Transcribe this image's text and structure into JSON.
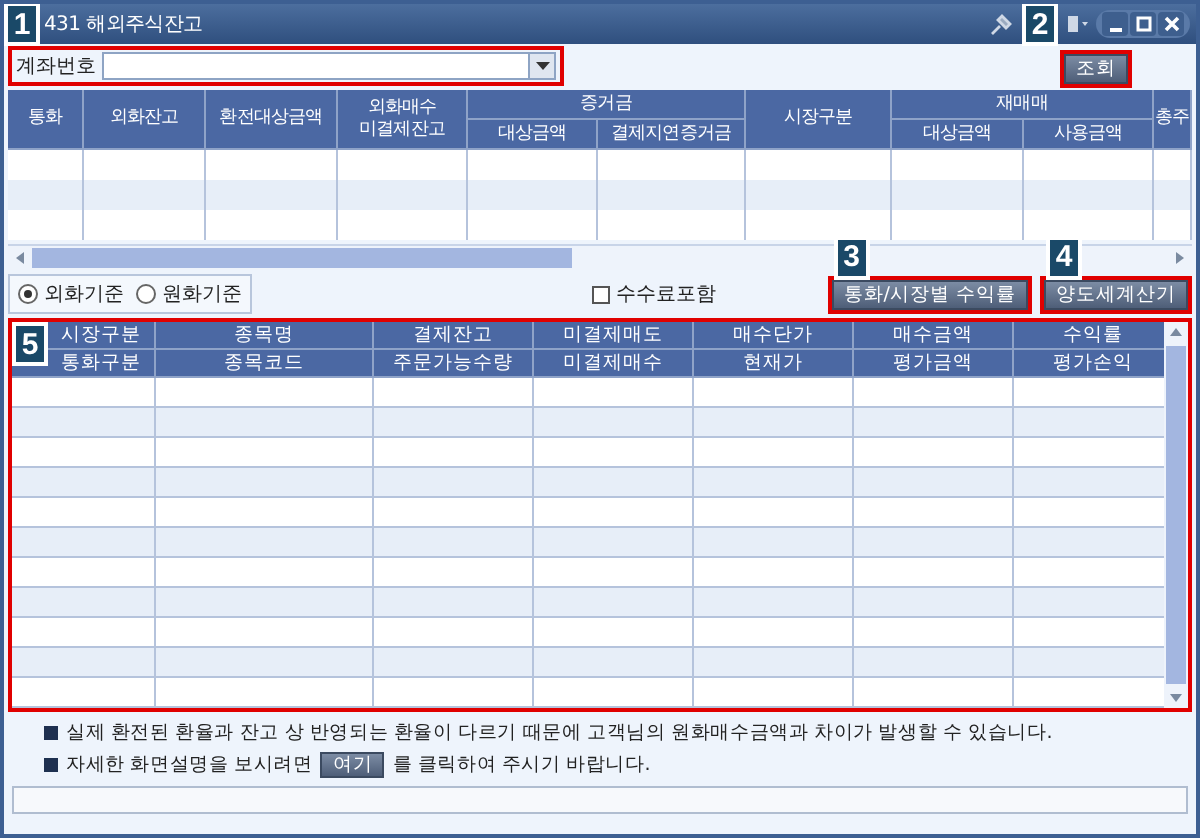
{
  "window": {
    "title": "431 해외주식잔고",
    "callout": "1"
  },
  "account": {
    "label": "계좌번호",
    "callout": "2",
    "query_button": "조회"
  },
  "upper_table": {
    "columns": [
      {
        "label": "통화"
      },
      {
        "label": "외화잔고"
      },
      {
        "label": "환전대상금액"
      },
      {
        "label": "외화매수\n미결제잔고"
      },
      {
        "label": "증거금",
        "sub": [
          "대상금액",
          "결제지연증거금"
        ]
      },
      {
        "label": "시장구분"
      },
      {
        "label": "재매매",
        "sub": [
          "대상금액",
          "사용금액"
        ]
      },
      {
        "label": "총주"
      }
    ]
  },
  "options": {
    "radios": [
      {
        "label": "외화기준",
        "selected": true
      },
      {
        "label": "원화기준",
        "selected": false
      }
    ],
    "checkbox": {
      "label": "수수료포함",
      "checked": false
    },
    "buttons": [
      {
        "label": "통화/시장별 수익률",
        "callout": "3"
      },
      {
        "label": "양도세계산기",
        "callout": "4"
      }
    ]
  },
  "lower_table": {
    "callout": "5",
    "columns": [
      {
        "top": "시장구분",
        "bottom": "통화구분"
      },
      {
        "top": "종목명",
        "bottom": "종목코드"
      },
      {
        "top": "결제잔고",
        "bottom": "주문가능수량"
      },
      {
        "top": "미결제매도",
        "bottom": "미결제매수"
      },
      {
        "top": "매수단가",
        "bottom": "현재가"
      },
      {
        "top": "매수금액",
        "bottom": "평가금액"
      },
      {
        "top": "수익률",
        "bottom": "평가손익"
      }
    ]
  },
  "notes": [
    {
      "kind": "text",
      "text": "실제 환전된 환율과 잔고 상 반영되는 환율이 다르기 때문에 고객님의 원화매수금액과 차이가 발생할 수 있습니다."
    },
    {
      "kind": "link",
      "before": "자세한 화면설명을 보시려면",
      "button": "여기",
      "after": "를 클릭하여 주시기 바랍니다."
    }
  ]
}
